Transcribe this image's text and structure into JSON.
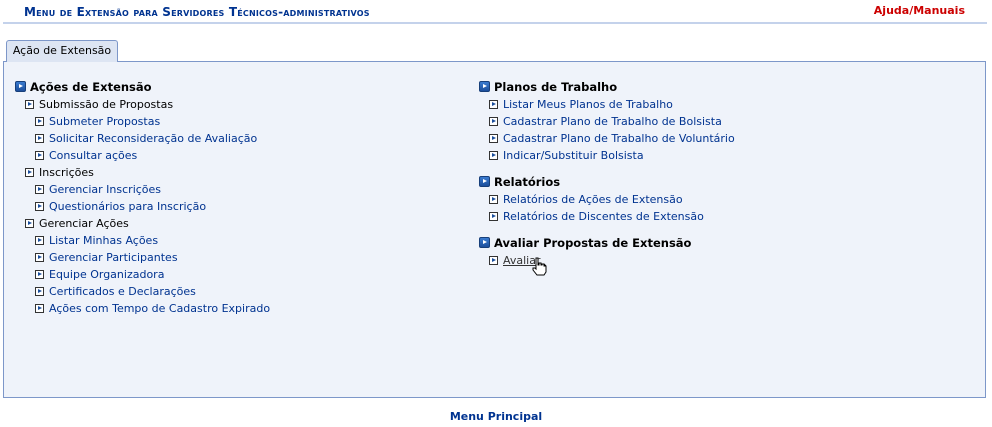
{
  "header": {
    "title": "Menu de Extensão para Servidores Técnicos-administrativos",
    "help_link": "Ajuda/Manuais"
  },
  "tab": {
    "label": "Ação de Extensão"
  },
  "left": {
    "section_title": "Ações de Extensão",
    "groups": [
      {
        "title": "Submissão de Propostas",
        "items": [
          "Submeter Propostas",
          "Solicitar Reconsideração de Avaliação",
          "Consultar ações"
        ]
      },
      {
        "title": "Inscrições",
        "items": [
          "Gerenciar Inscrições",
          "Questionários para Inscrição"
        ]
      },
      {
        "title": "Gerenciar Ações",
        "items": [
          "Listar Minhas Ações",
          "Gerenciar Participantes",
          "Equipe Organizadora",
          "Certificados e Declarações",
          "Ações com Tempo de Cadastro Expirado"
        ]
      }
    ]
  },
  "right": {
    "sections": [
      {
        "title": "Planos de Trabalho",
        "items": [
          "Listar Meus Planos de Trabalho",
          "Cadastrar Plano de Trabalho de Bolsista",
          "Cadastrar Plano de Trabalho de Voluntário",
          "Indicar/Substituir Bolsista"
        ]
      },
      {
        "title": "Relatórios",
        "items": [
          "Relatórios de Ações de Extensão",
          "Relatórios de Discentes de Extensão"
        ]
      },
      {
        "title": "Avaliar Propostas de Extensão",
        "items": [
          "Avaliar"
        ]
      }
    ]
  },
  "footer": {
    "link": "Menu Principal"
  },
  "colors": {
    "link": "#003390",
    "help": "#cc0000",
    "panel_bg": "#eff3fa",
    "border": "#7d97c9"
  }
}
